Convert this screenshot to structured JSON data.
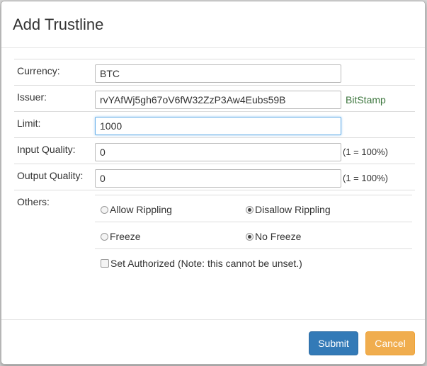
{
  "modal": {
    "title": "Add Trustline"
  },
  "fields": {
    "currency": {
      "label": "Currency:",
      "value": "BTC"
    },
    "issuer": {
      "label": "Issuer:",
      "value": "rvYAfWj5gh67oV6fW32ZzP3Aw4Eubs59B",
      "name": "BitStamp"
    },
    "limit": {
      "label": "Limit:",
      "value": "1000"
    },
    "input_quality": {
      "label": "Input Quality:",
      "value": "0",
      "suffix": "(1 = 100%)"
    },
    "output_quality": {
      "label": "Output Quality:",
      "value": "0",
      "suffix": "(1 = 100%)"
    }
  },
  "others": {
    "label": "Others:",
    "allow_rippling": "Allow Rippling",
    "disallow_rippling": "Disallow Rippling",
    "freeze": "Freeze",
    "no_freeze": "No Freeze",
    "set_authorized": "Set Authorized (Note: this cannot be unset.)"
  },
  "footer": {
    "submit_label": "Submit",
    "cancel_label": "Cancel"
  },
  "colors": {
    "primary": "#337ab7",
    "warning": "#f0ad4e",
    "issuer_name": "#3c763d"
  }
}
